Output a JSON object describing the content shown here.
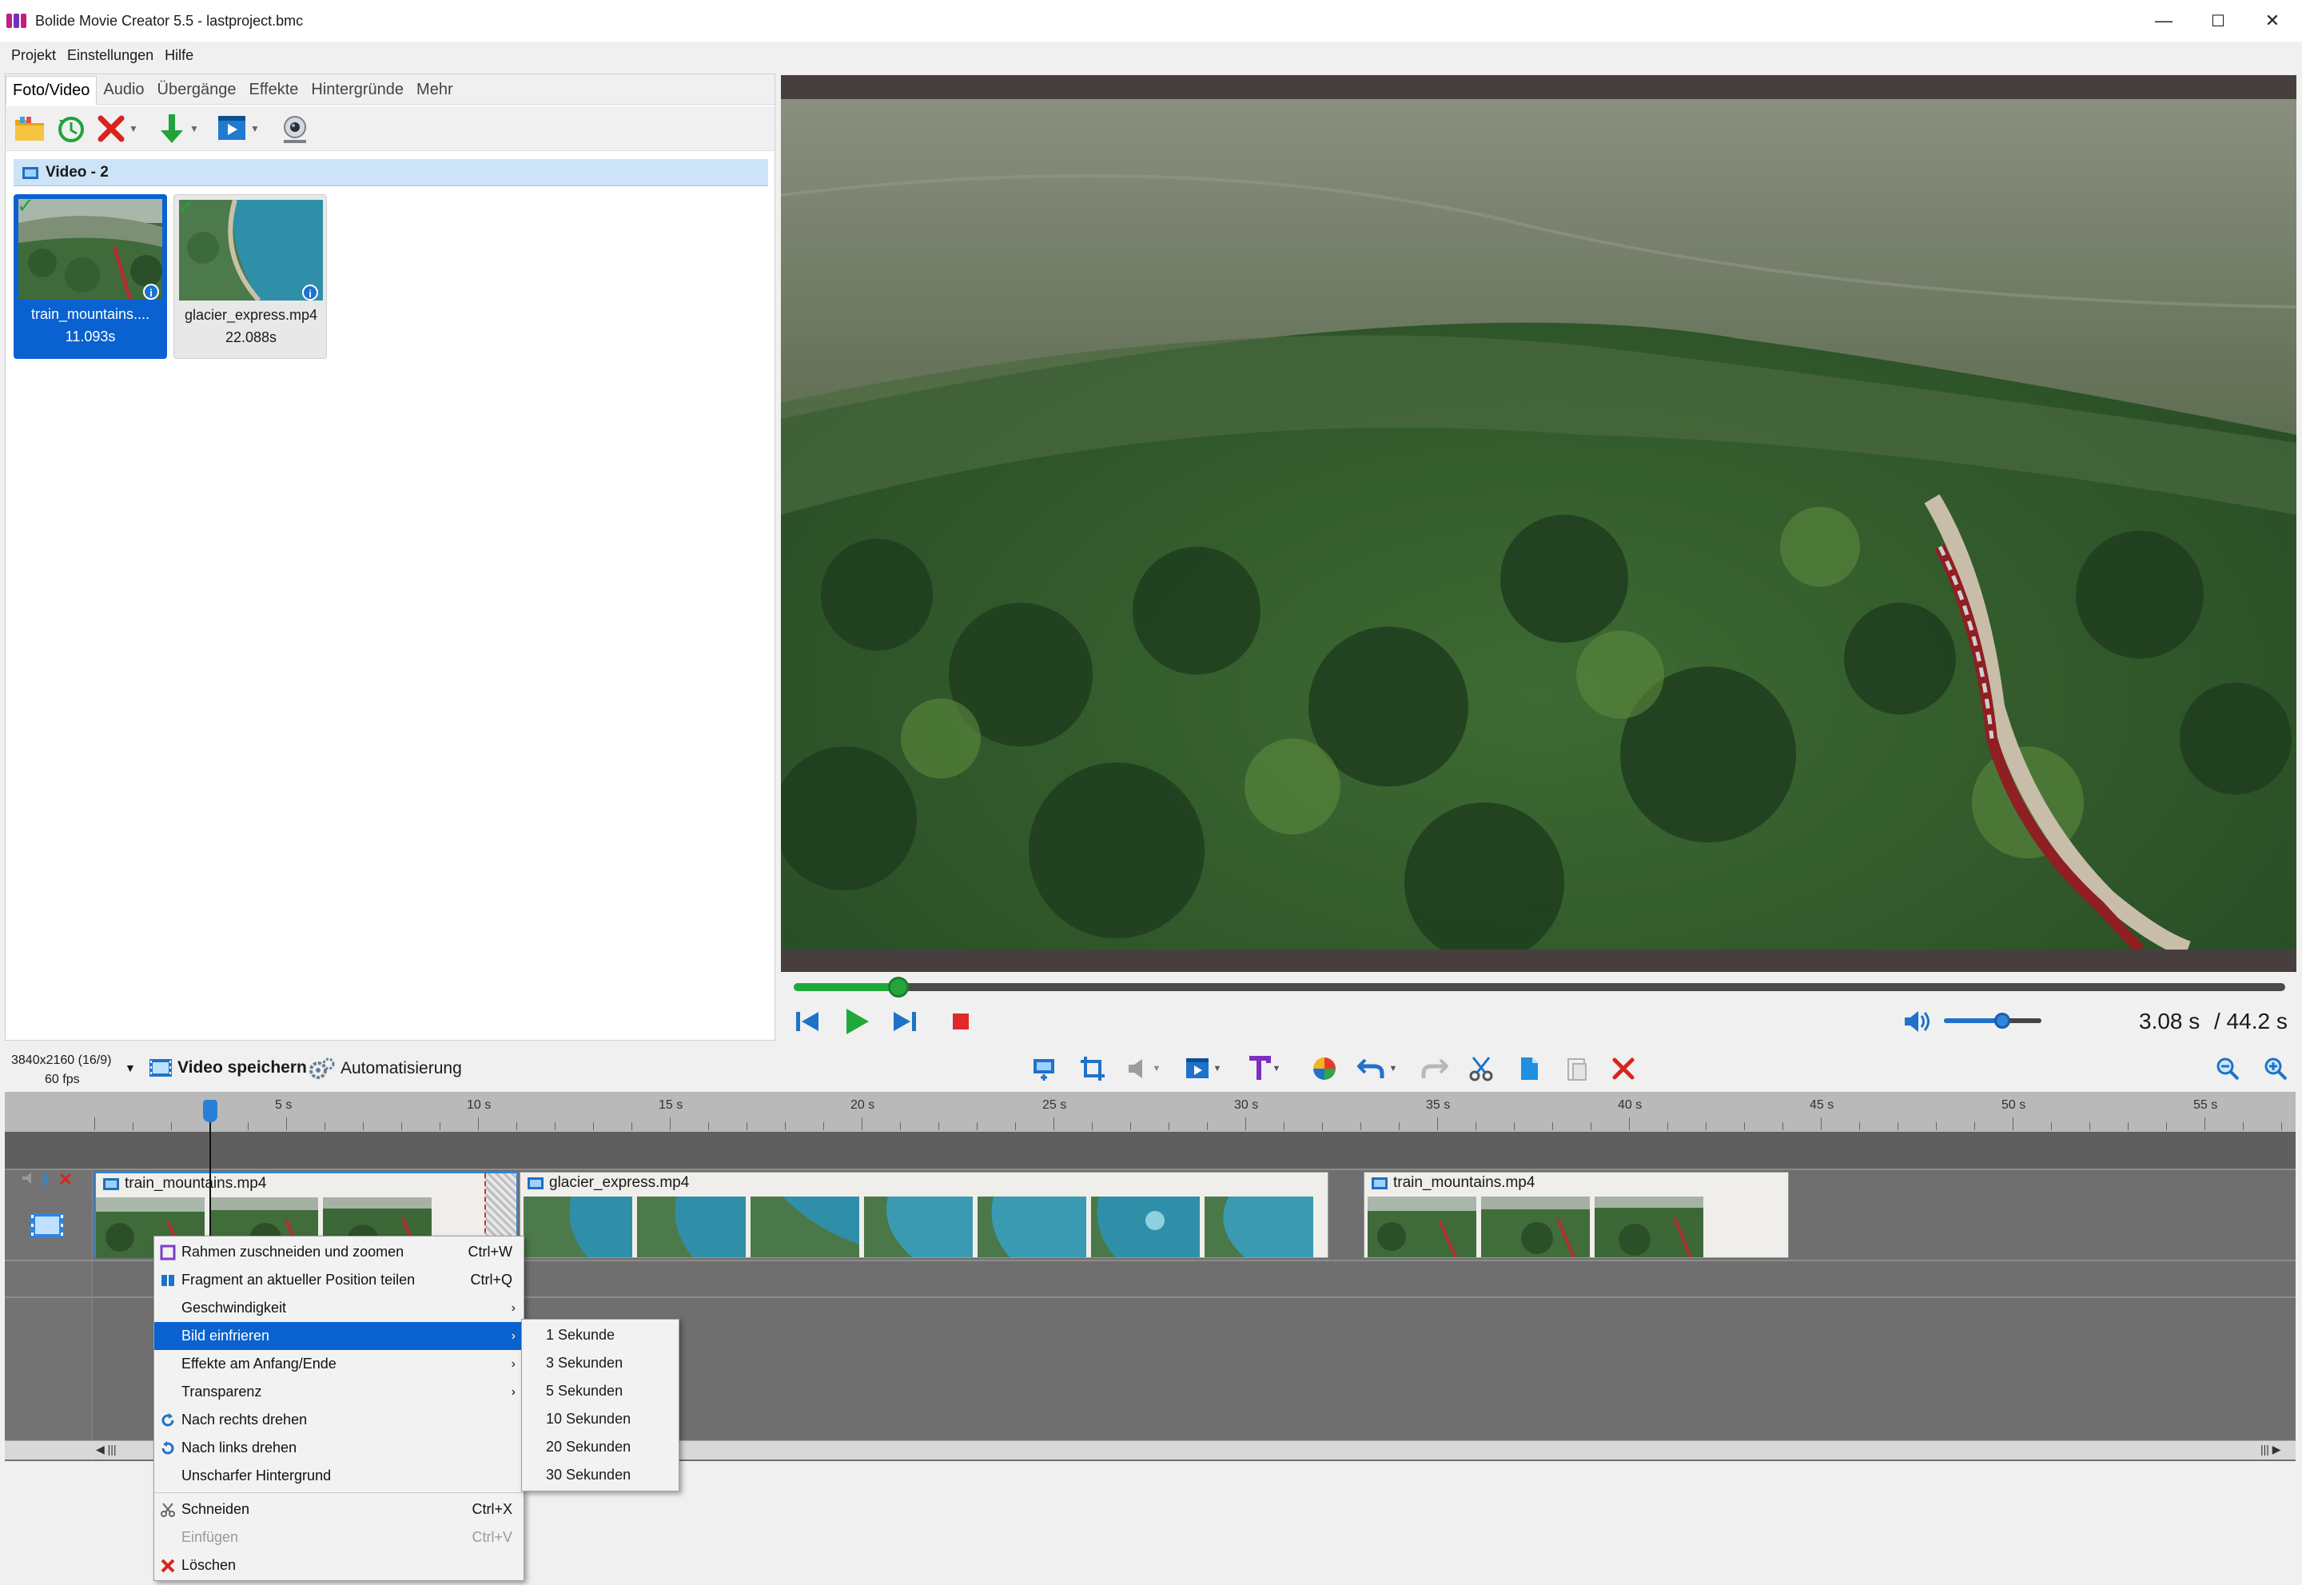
{
  "window": {
    "title": "Bolide Movie Creator 5.5 - lastproject.bmc",
    "minimize": "—",
    "maximize": "☐",
    "close": "✕"
  },
  "menubar": [
    "Projekt",
    "Einstellungen",
    "Hilfe"
  ],
  "tabs": [
    "Foto/Video",
    "Audio",
    "Übergänge",
    "Effekte",
    "Hintergründe",
    "Mehr"
  ],
  "media": {
    "group_label": "Video - 2",
    "items": [
      {
        "name": "train_mountains....",
        "duration": "11.093s"
      },
      {
        "name": "glacier_express.mp4",
        "duration": "22.088s"
      }
    ]
  },
  "player": {
    "current_time": "3.08 s",
    "total_time": "/ 44.2 s",
    "progress_fraction": 0.07,
    "volume_fraction": 0.6
  },
  "project": {
    "resolution": "3840x2160 (16/9)",
    "fps": "60 fps",
    "save_label": "Video speichern",
    "automation_label": "Automatisierung"
  },
  "timeline": {
    "ticks": [
      "5 s",
      "10 s",
      "15 s",
      "20 s",
      "25 s",
      "30 s",
      "35 s",
      "40 s",
      "45 s",
      "50 s",
      "55 s"
    ],
    "clips": [
      {
        "name": "train_mountains.mp4"
      },
      {
        "name": "glacier_express.mp4"
      },
      {
        "name": "train_mountains.mp4"
      }
    ]
  },
  "context_menu": {
    "items": [
      {
        "label": "Rahmen zuschneiden und zoomen",
        "shortcut": "Ctrl+W"
      },
      {
        "label": "Fragment an aktueller Position teilen",
        "shortcut": "Ctrl+Q"
      },
      {
        "label": "Geschwindigkeit",
        "shortcut": "›"
      },
      {
        "label": "Bild einfrieren",
        "shortcut": "›"
      },
      {
        "label": "Effekte am Anfang/Ende",
        "shortcut": "›"
      },
      {
        "label": "Transparenz",
        "shortcut": "›"
      },
      {
        "label": "Nach rechts drehen",
        "shortcut": ""
      },
      {
        "label": "Nach links drehen",
        "shortcut": ""
      },
      {
        "label": "Unscharfer Hintergrund",
        "shortcut": ""
      },
      {
        "label": "Schneiden",
        "shortcut": "Ctrl+X"
      },
      {
        "label": "Einfügen",
        "shortcut": "Ctrl+V"
      },
      {
        "label": "Löschen",
        "shortcut": ""
      }
    ]
  },
  "submenu": {
    "items": [
      "1 Sekunde",
      "3 Sekunden",
      "5 Sekunden",
      "10 Sekunden",
      "20 Sekunden",
      "30 Sekunden"
    ]
  },
  "colors": {
    "accent": "#0a62d0",
    "progress": "#21a83b",
    "delete": "#d9241e"
  }
}
